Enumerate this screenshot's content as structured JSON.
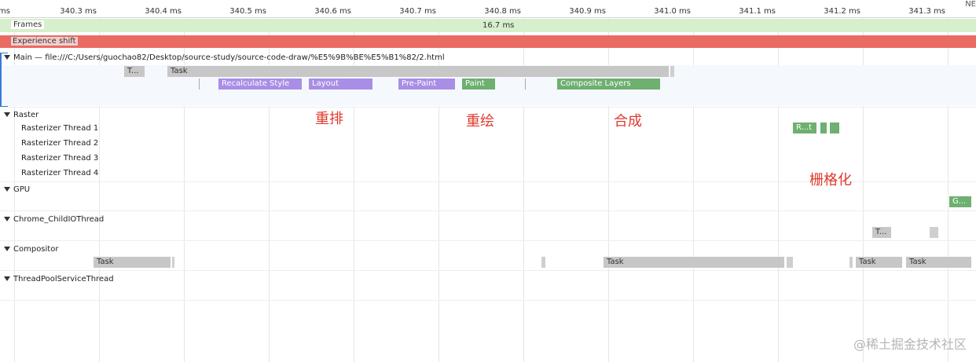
{
  "ruler": {
    "ticks": [
      "ms",
      "340.3 ms",
      "340.4 ms",
      "340.5 ms",
      "340.6 ms",
      "340.7 ms",
      "340.8 ms",
      "340.9 ms",
      "341.0 ms",
      "341.1 ms",
      "341.2 ms",
      "341.3 ms"
    ],
    "corner": "NE"
  },
  "frames": {
    "label": "Frames",
    "fps": "16.7 ms"
  },
  "experience": {
    "label": "Experience shift"
  },
  "main": {
    "title": "Main — file:///C:/Users/guochao82/Desktop/source-study/source-code-draw/%E5%9B%BE%E5%B1%82/2.html",
    "events": {
      "t_small": "T...",
      "task": "Task",
      "recalc": "Recalculate Style",
      "layout": "Layout",
      "prepaint": "Pre-Paint",
      "paint": "Paint",
      "composite": "Composite Layers"
    }
  },
  "raster": {
    "title": "Raster",
    "threads": [
      "Rasterizer Thread 1",
      "Rasterizer Thread 2",
      "Rasterizer Thread 3",
      "Rasterizer Thread 4"
    ],
    "event": "R...t"
  },
  "gpu": {
    "title": "GPU",
    "event": "G..."
  },
  "childio": {
    "title": "Chrome_ChildIOThread",
    "event": "T..."
  },
  "compositor": {
    "title": "Compositor",
    "task1": "Task",
    "task2": "Task",
    "task3": "Task",
    "task4": "Task"
  },
  "threadpool": {
    "title": "ThreadPoolServiceThread"
  },
  "annotations": {
    "reflow": "重排",
    "repaint": "重绘",
    "composite": "合成",
    "rasterize": "栅格化"
  },
  "watermark": "@稀土掘金技术社区",
  "colors": {
    "rendering": "#a98ee6",
    "painting": "#6eb070",
    "task": "#c7c7c7",
    "experience": "#ea6a64",
    "frames": "#d6efcc",
    "annotation": "#e03a2e"
  }
}
